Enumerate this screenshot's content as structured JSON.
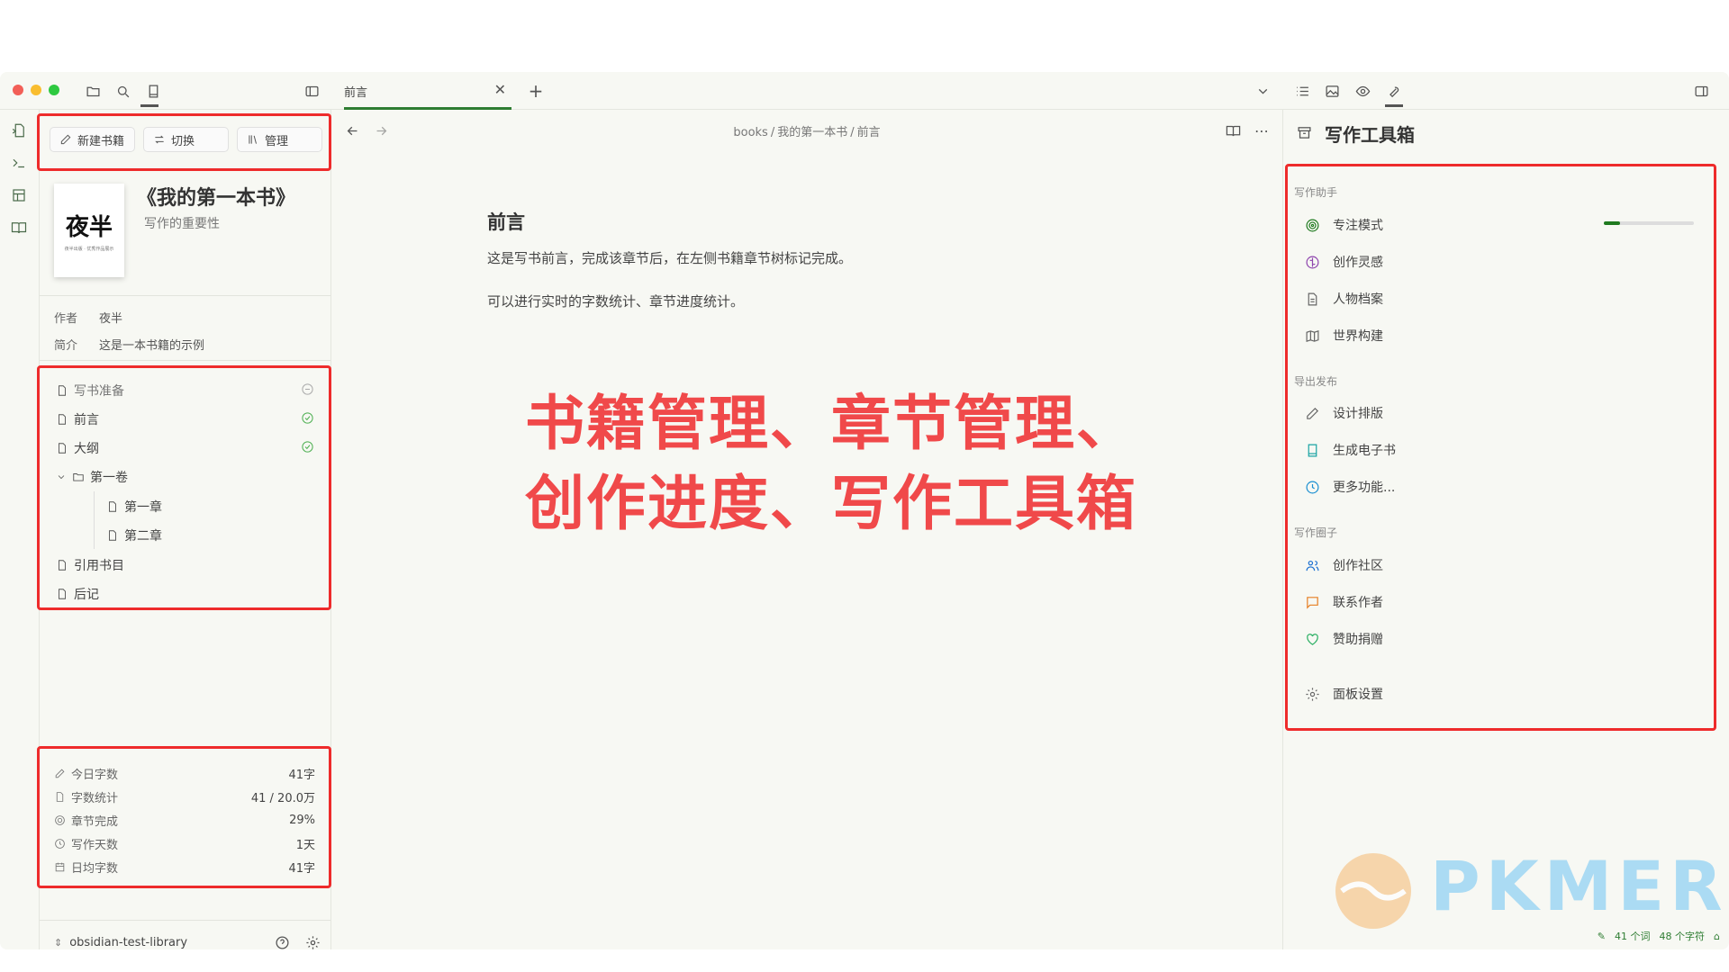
{
  "topbar": {
    "tab_title": "前言"
  },
  "left": {
    "buttons": {
      "new_book": "新建书籍",
      "switch": "切换",
      "manage": "管理"
    },
    "cover": {
      "title": "夜半",
      "subtitle": "夜半出版 · 优秀作品展示"
    },
    "book_title": "《我的第一本书》",
    "book_subtitle": "写作的重要性",
    "meta": {
      "author_label": "作者",
      "author": "夜半",
      "intro_label": "简介",
      "intro": "这是一本书籍的示例"
    },
    "tree": {
      "prep": "写书准备",
      "preface": "前言",
      "outline": "大纲",
      "volume1": "第一卷",
      "chapter1": "第一章",
      "chapter2": "第二章",
      "references": "引用书目",
      "afterword": "后记"
    },
    "stats": [
      {
        "label": "今日字数",
        "value": "41字"
      },
      {
        "label": "字数统计",
        "value": "41 / 20.0万"
      },
      {
        "label": "章节完成",
        "value": "29%"
      },
      {
        "label": "写作天数",
        "value": "1天"
      },
      {
        "label": "日均字数",
        "value": "41字"
      }
    ],
    "vault": "obsidian-test-library"
  },
  "main": {
    "breadcrumb": [
      "books",
      "我的第一本书",
      "前言"
    ],
    "heading": "前言",
    "para1": "这是写书前言，完成该章节后，在左侧书籍章节树标记完成。",
    "para2": "可以进行实时的字数统计、章节进度统计。",
    "overlay_line1": "书籍管理、章节管理、",
    "overlay_line2": "创作进度、写作工具箱"
  },
  "right": {
    "title": "写作工具箱",
    "sections": {
      "assist": "写作助手",
      "export": "导出发布",
      "circle": "写作圈子"
    },
    "items": {
      "focus": "专注模式",
      "inspiration": "创作灵感",
      "characters": "人物档案",
      "world": "世界构建",
      "design": "设计排版",
      "ebook": "生成电子书",
      "more": "更多功能...",
      "community": "创作社区",
      "contact": "联系作者",
      "donate": "赞助捐赠",
      "settings": "面板设置"
    },
    "focus_level": 0.18
  },
  "statusbar": {
    "words": "41 个词",
    "chars": "48 个字符"
  },
  "watermark": "PKMER",
  "colors": {
    "accent": "#2e7d32",
    "highlight": "#ee2b2b",
    "overlay_text": "#f0494a"
  }
}
